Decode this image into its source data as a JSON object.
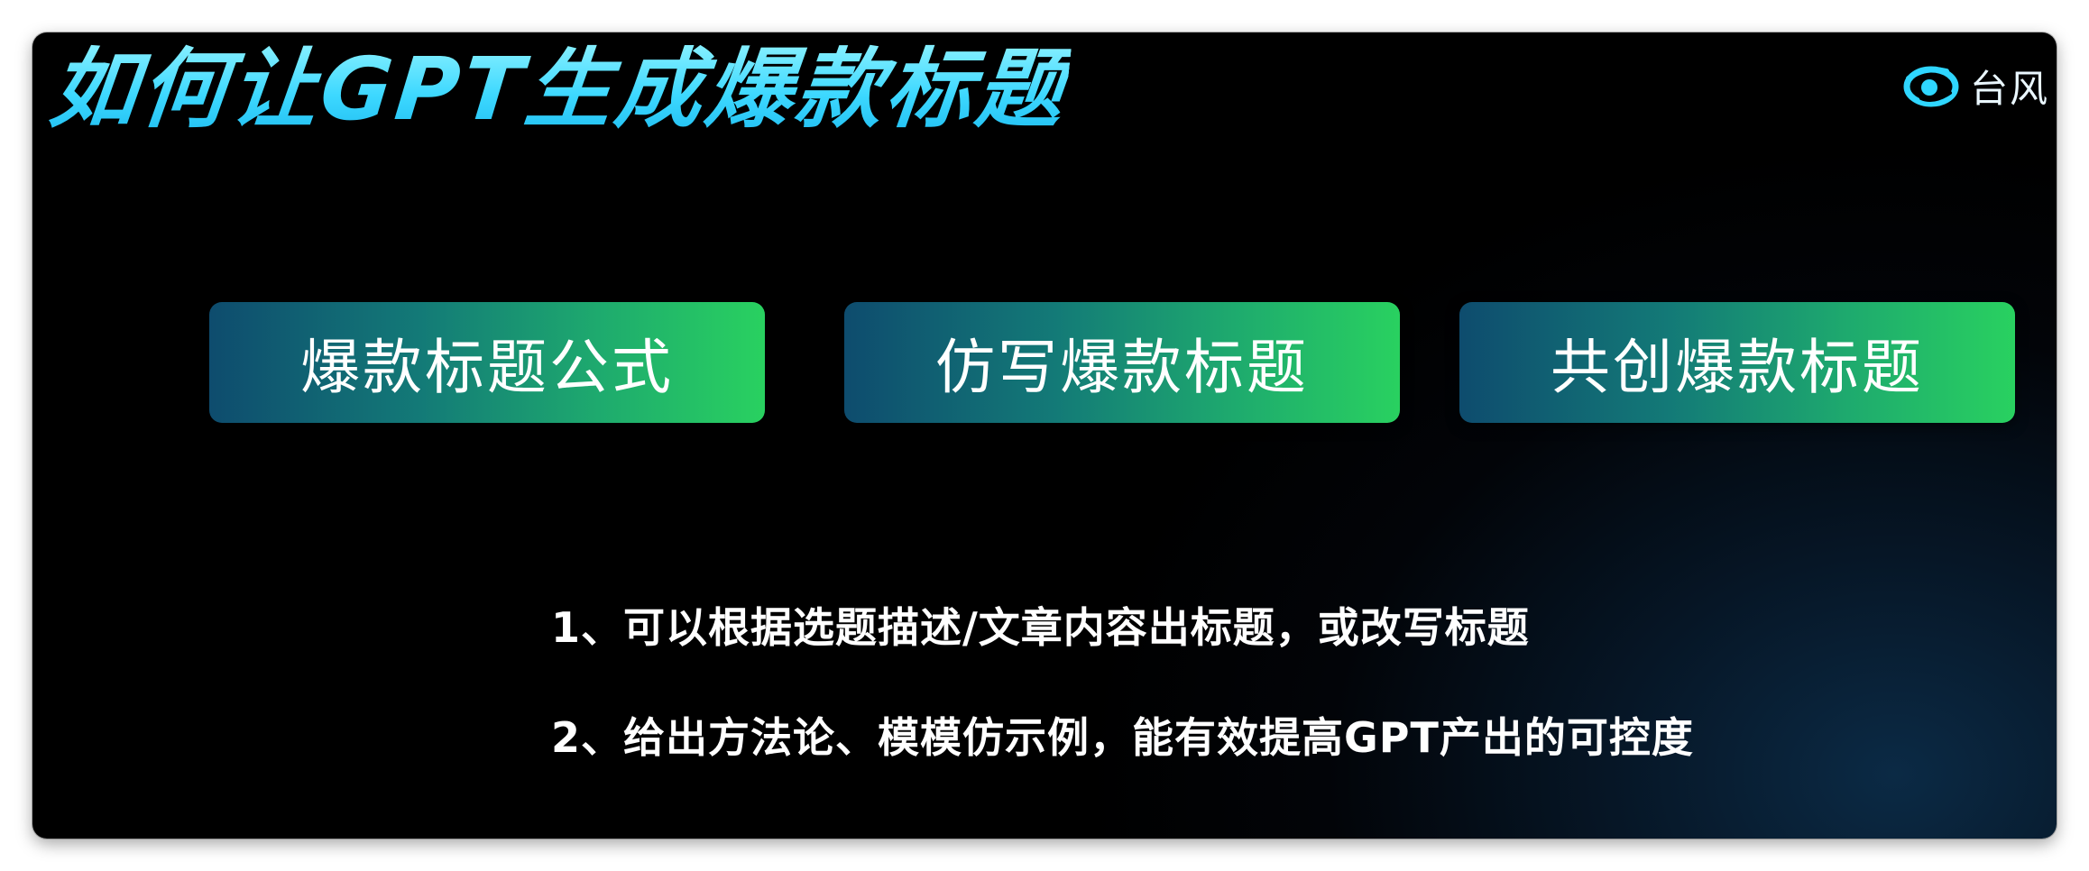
{
  "title": "如何让GPT生成爆款标题",
  "logo": {
    "icon": "swirl-icon",
    "text": "台风",
    "color": "#2fd6ff"
  },
  "buttons": [
    {
      "label": "爆款标题公式"
    },
    {
      "label": "仿写爆款标题"
    },
    {
      "label": "共创爆款标题"
    }
  ],
  "points": [
    "1、可以根据选题描述/文章内容出标题，或改写标题",
    "2、给出方法论、模模仿示例，能有效提高GPT产出的可控度"
  ],
  "colors": {
    "title": "#3dd8ff",
    "button_gradient_start": "#0e4c6e",
    "button_gradient_end": "#29d160",
    "background": "#000000"
  }
}
